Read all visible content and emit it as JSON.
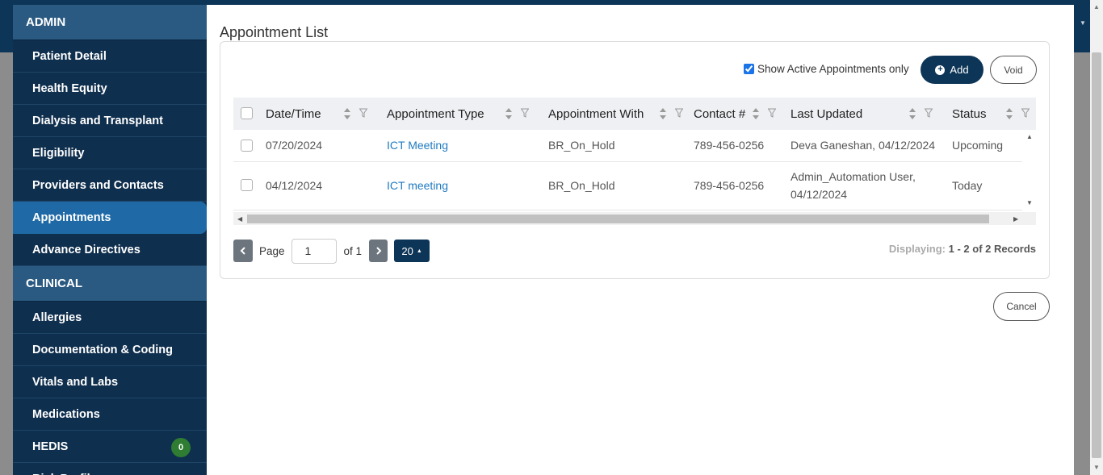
{
  "sidebar": {
    "sections": [
      {
        "title": "ADMIN"
      },
      {
        "title": "CLINICAL"
      }
    ],
    "admin_items": [
      {
        "label": "Patient Detail"
      },
      {
        "label": "Health Equity"
      },
      {
        "label": "Dialysis and Transplant"
      },
      {
        "label": "Eligibility"
      },
      {
        "label": "Providers and Contacts"
      },
      {
        "label": "Appointments",
        "active": true
      },
      {
        "label": "Advance Directives"
      }
    ],
    "clinical_items": [
      {
        "label": "Allergies"
      },
      {
        "label": "Documentation & Coding"
      },
      {
        "label": "Vitals and Labs"
      },
      {
        "label": "Medications"
      },
      {
        "label": "HEDIS",
        "badge": "0"
      },
      {
        "label": "Risk Profile"
      }
    ]
  },
  "modal": {
    "title": "Appointment List",
    "show_active_label": "Show Active Appointments only",
    "show_active_checked": true,
    "add_label": "Add",
    "void_label": "Void",
    "cancel_label": "Cancel"
  },
  "table": {
    "columns": [
      "Date/Time",
      "Appointment Type",
      "Appointment With",
      "Contact #",
      "Last Updated",
      "Status"
    ],
    "rows": [
      {
        "date": "07/20/2024",
        "type": "ICT Meeting",
        "with": "BR_On_Hold",
        "contact": "789-456-0256",
        "updated_line1": "Deva Ganeshan, 04/12/2024",
        "updated_line2": "",
        "status": "Upcoming"
      },
      {
        "date": "04/12/2024",
        "type": "ICT meeting",
        "with": "BR_On_Hold",
        "contact": "789-456-0256",
        "updated_line1": "Admin_Automation User,",
        "updated_line2": "04/12/2024",
        "status": "Today"
      }
    ]
  },
  "pagination": {
    "page_label": "Page",
    "page_value": "1",
    "of_label": "of 1",
    "page_size": "20",
    "displaying_label": "Displaying:",
    "records_text": "1 - 2 of 2 Records"
  },
  "colors": {
    "navy": "#0d3557",
    "sidebar_bg": "#0f2f4e",
    "section_header": "#2a5a82",
    "active_item": "#1f6aa6",
    "link": "#1f7ac0",
    "badge": "#2e7d32"
  }
}
